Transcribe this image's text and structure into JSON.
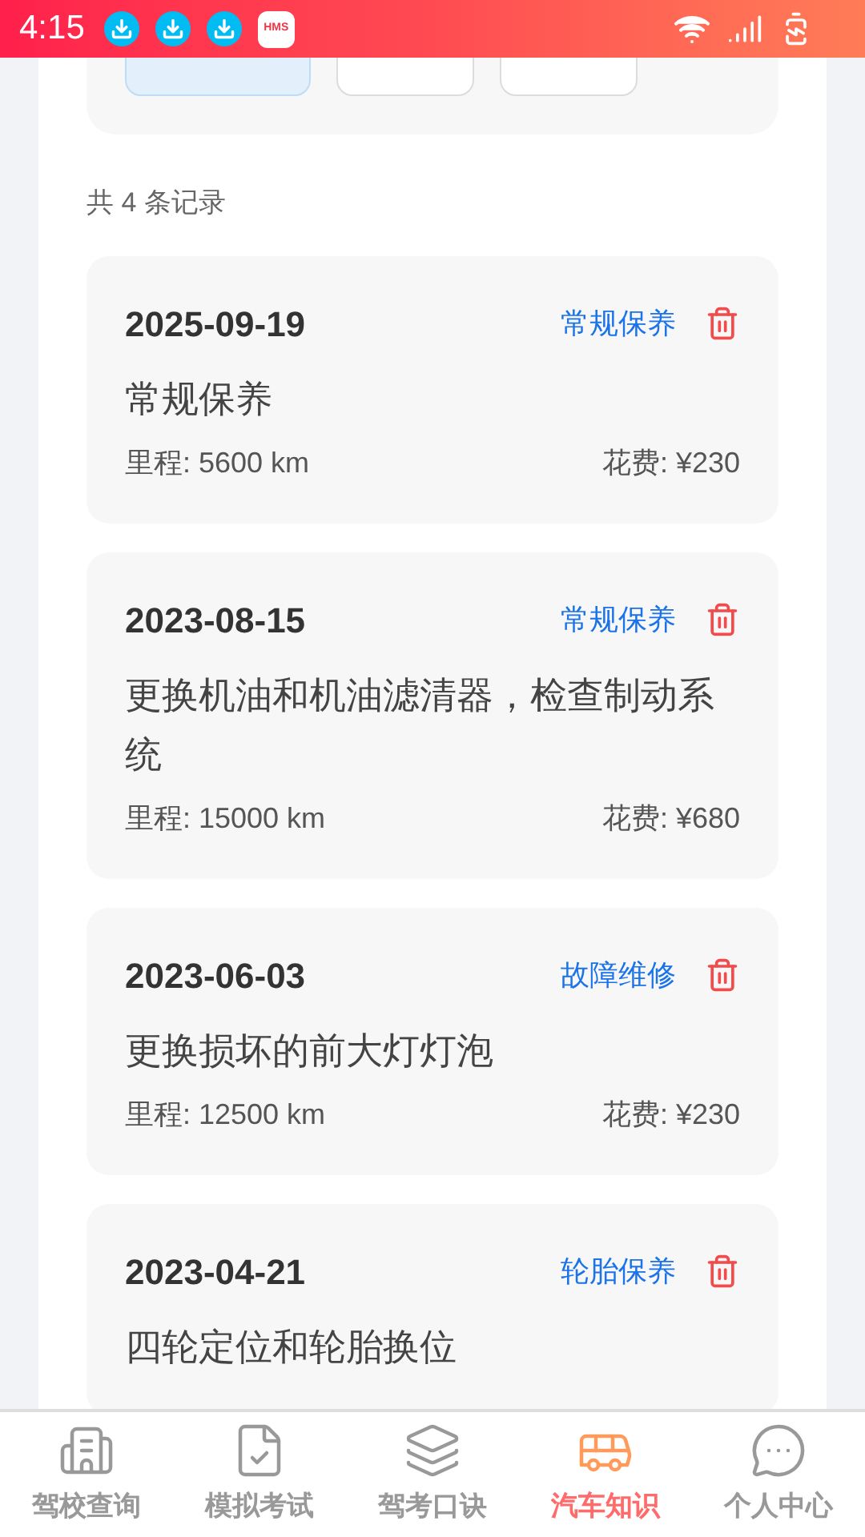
{
  "status_bar": {
    "time": "4:15",
    "notifications": [
      {
        "kind": "download"
      },
      {
        "kind": "download"
      },
      {
        "kind": "download"
      },
      {
        "kind": "hms",
        "label": "HMS"
      }
    ]
  },
  "filters": [
    {
      "selected": true
    },
    {
      "selected": false
    },
    {
      "selected": false
    }
  ],
  "record_count": "共 4 条记录",
  "records": [
    {
      "date": "2025-09-19",
      "type": "常规保养",
      "description": "常规保养",
      "mileage": "里程: 5600 km",
      "cost": "花费: ¥230"
    },
    {
      "date": "2023-08-15",
      "type": "常规保养",
      "description": "更换机油和机油滤清器，检查制动系统",
      "mileage": "里程: 15000 km",
      "cost": "花费: ¥680"
    },
    {
      "date": "2023-06-03",
      "type": "故障维修",
      "description": "更换损坏的前大灯灯泡",
      "mileage": "里程: 12500 km",
      "cost": "花费: ¥230"
    },
    {
      "date": "2023-04-21",
      "type": "轮胎保养",
      "description": "四轮定位和轮胎换位"
    }
  ],
  "bottom_nav": [
    {
      "kind": "school",
      "label": "驾校查询",
      "selected": false
    },
    {
      "kind": "exam",
      "label": "模拟考试",
      "selected": false
    },
    {
      "kind": "cards",
      "label": "驾考口诀",
      "selected": false
    },
    {
      "kind": "bus",
      "label": "汽车知识",
      "selected": true
    },
    {
      "kind": "profile",
      "label": "个人中心",
      "selected": false
    }
  ]
}
